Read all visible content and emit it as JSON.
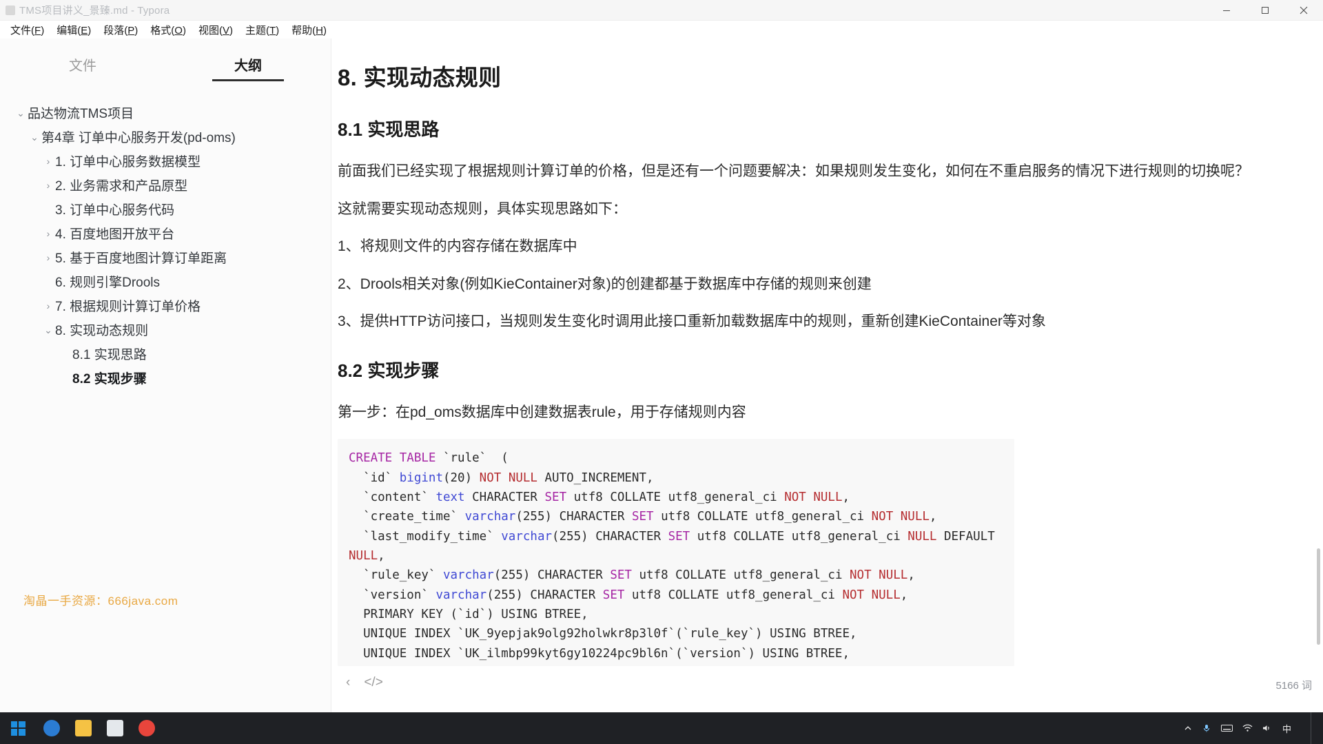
{
  "window": {
    "title": "TMS项目讲义_景臻.md - Typora",
    "controls": {
      "minimize": "minimize-icon",
      "maximize": "maximize-icon",
      "close": "close-icon"
    }
  },
  "menubar": [
    {
      "label": "文件",
      "mnemonic": "F"
    },
    {
      "label": "编辑",
      "mnemonic": "E"
    },
    {
      "label": "段落",
      "mnemonic": "P"
    },
    {
      "label": "格式",
      "mnemonic": "O"
    },
    {
      "label": "视图",
      "mnemonic": "V"
    },
    {
      "label": "主题",
      "mnemonic": "T"
    },
    {
      "label": "帮助",
      "mnemonic": "H"
    }
  ],
  "sidebar": {
    "tabs": [
      {
        "label": "文件",
        "active": false
      },
      {
        "label": "大纲",
        "active": true
      }
    ],
    "outline": [
      {
        "label": "品达物流TMS项目",
        "level": 0,
        "caret": "expanded",
        "bold": false
      },
      {
        "label": "第4章 订单中心服务开发(pd-oms)",
        "level": 1,
        "caret": "expanded",
        "bold": false
      },
      {
        "label": "1. 订单中心服务数据模型",
        "level": 2,
        "caret": "collapsed",
        "bold": false
      },
      {
        "label": "2. 业务需求和产品原型",
        "level": 2,
        "caret": "collapsed",
        "bold": false
      },
      {
        "label": "3. 订单中心服务代码",
        "level": 2,
        "caret": "none",
        "bold": false
      },
      {
        "label": "4. 百度地图开放平台",
        "level": 2,
        "caret": "collapsed",
        "bold": false
      },
      {
        "label": "5. 基于百度地图计算订单距离",
        "level": 2,
        "caret": "collapsed",
        "bold": false
      },
      {
        "label": "6. 规则引擎Drools",
        "level": 2,
        "caret": "none",
        "bold": false
      },
      {
        "label": "7. 根据规则计算订单价格",
        "level": 2,
        "caret": "collapsed",
        "bold": false
      },
      {
        "label": "8. 实现动态规则",
        "level": 2,
        "caret": "expanded",
        "bold": false
      },
      {
        "label": "8.1 实现思路",
        "level": 3,
        "caret": "none",
        "bold": false
      },
      {
        "label": "8.2 实现步骤",
        "level": 3,
        "caret": "none",
        "bold": true
      }
    ],
    "watermark": "淘晶一手资源：666java.com"
  },
  "document": {
    "h1": "8. 实现动态规则",
    "h2_1": "8.1 实现思路",
    "p1": "前面我们已经实现了根据规则计算订单的价格，但是还有一个问题要解决：如果规则发生变化，如何在不重启服务的情况下进行规则的切换呢？",
    "p2": "这就需要实现动态规则，具体实现思路如下：",
    "li1": "1、将规则文件的内容存储在数据库中",
    "li2": "2、Drools相关对象(例如KieContainer对象)的创建都基于数据库中存储的规则来创建",
    "li3": "3、提供HTTP访问接口，当规则发生变化时调用此接口重新加载数据库中的规则，重新创建KieContainer等对象",
    "h2_2": "8.2 实现步骤",
    "p3": "第一步：在pd_oms数据库中创建数据表rule，用于存储规则内容",
    "code_lines": [
      "CREATE TABLE `rule`  (",
      "  `id` bigint(20) NOT NULL AUTO_INCREMENT,",
      "  `content` text CHARACTER SET utf8 COLLATE utf8_general_ci NOT NULL,",
      "  `create_time` varchar(255) CHARACTER SET utf8 COLLATE utf8_general_ci NOT NULL,",
      "  `last_modify_time` varchar(255) CHARACTER SET utf8 COLLATE utf8_general_ci NULL DEFAULT NULL,",
      "  `rule_key` varchar(255) CHARACTER SET utf8 COLLATE utf8_general_ci NOT NULL,",
      "  `version` varchar(255) CHARACTER SET utf8 COLLATE utf8_general_ci NOT NULL,",
      "  PRIMARY KEY (`id`) USING BTREE,",
      "  UNIQUE INDEX `UK_9yepjak9olg92holwkr8p3l0f`(`rule_key`) USING BTREE,",
      "  UNIQUE INDEX `UK_ilmbp99kyt6gy10224pc9bl6n`(`version`) USING BTREE,"
    ]
  },
  "editor_status": {
    "prev_label": "‹",
    "source_label": "</>",
    "word_count": "5166 词"
  },
  "taskbar": {
    "start": "windows-start-icon",
    "apps": [
      {
        "name": "edge-icon",
        "color": "#2b7cd3"
      },
      {
        "name": "file-explorer-icon",
        "color": "#f5c244"
      },
      {
        "name": "notepad-icon",
        "color": "#dfe3e8"
      },
      {
        "name": "chrome-icon",
        "color": "#e8453c"
      }
    ],
    "tray": {
      "chevron": "chevron-up-icon",
      "mic": "microphone-icon",
      "keyboard": "keyboard-icon",
      "network": "network-icon",
      "volume": "volume-icon",
      "ime": "中",
      "clock_time": "",
      "showdesktop": "show-desktop-button"
    }
  },
  "colors": {
    "accent": "#2e2e2e",
    "keyword": "#a626a4",
    "type": "#4049d4",
    "notnull": "#b52d30",
    "watermark": "#e8a43a",
    "taskbar": "#1f2125"
  }
}
